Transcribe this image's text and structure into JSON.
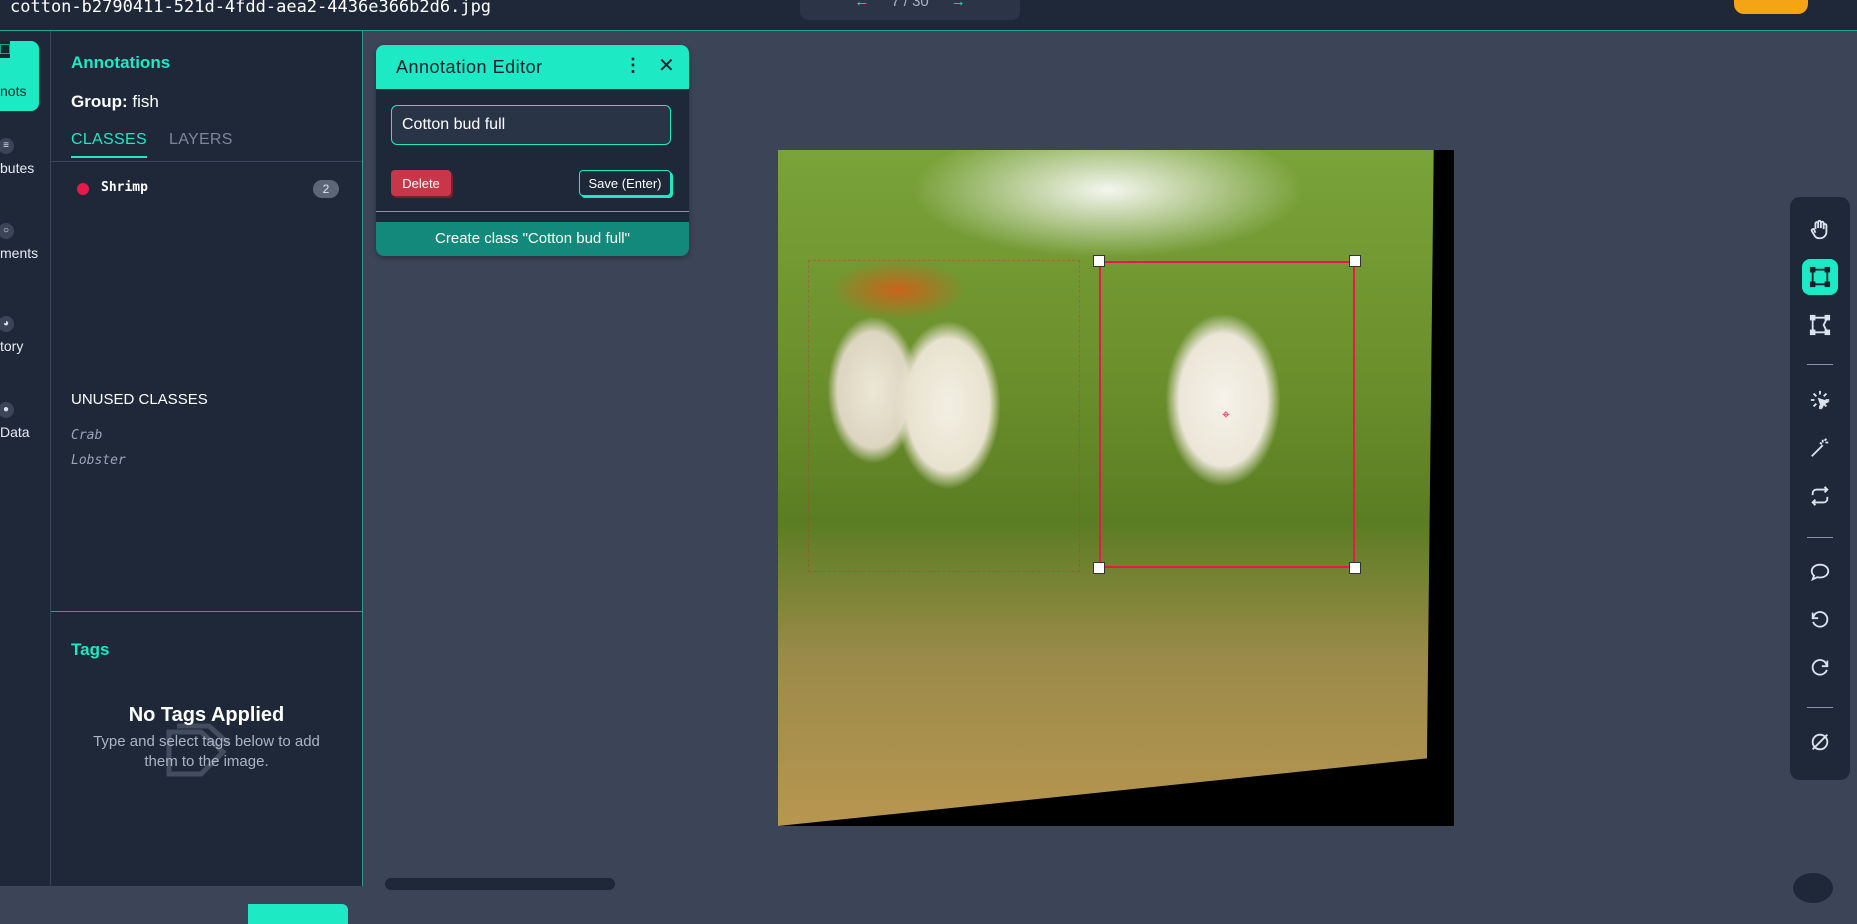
{
  "topbar": {
    "filename": "cotton-b2790411-521d-4fdd-aea2-4436e366b2d6.jpg",
    "pager_text": "7 / 30"
  },
  "rail": {
    "items": [
      {
        "label": "Annots",
        "icon": "annotations-icon"
      },
      {
        "label": "Attributes",
        "icon": "list-icon"
      },
      {
        "label": "Comments",
        "icon": "comment-icon"
      },
      {
        "label": "History",
        "icon": "history-icon"
      },
      {
        "label": "Raw Data",
        "icon": "data-icon"
      }
    ]
  },
  "sidebar": {
    "title": "Annotations",
    "group_label": "Group:",
    "group_value": "fish",
    "tabs": [
      "CLASSES",
      "LAYERS"
    ],
    "classes": [
      {
        "name": "Shrimp",
        "count": "2",
        "color": "#e6194b"
      }
    ],
    "unused_title": "UNUSED CLASSES",
    "unused_classes": [
      "Crab",
      "Lobster"
    ]
  },
  "tags": {
    "title": "Tags",
    "empty_title": "No Tags Applied",
    "empty_sub": "Type and select tags below to add them to the image."
  },
  "editor": {
    "title": "Annotation Editor",
    "input_value": "Cotton bud full",
    "delete_label": "Delete",
    "save_label": "Save (Enter)",
    "create_label": "Create class \"Cotton bud full\""
  },
  "toolbar": {
    "tools": [
      "hand-icon",
      "bounding-box-icon",
      "polygon-icon",
      "smart-select-icon",
      "magic-wand-icon",
      "repeat-icon",
      "comment-icon",
      "undo-icon",
      "redo-icon",
      "null-icon"
    ],
    "active_tool": "bounding-box-icon"
  },
  "colors": {
    "accent": "#1de9c5",
    "panel": "#1e2839",
    "canvas": "#3b4557",
    "annotation": "#e6194b"
  }
}
